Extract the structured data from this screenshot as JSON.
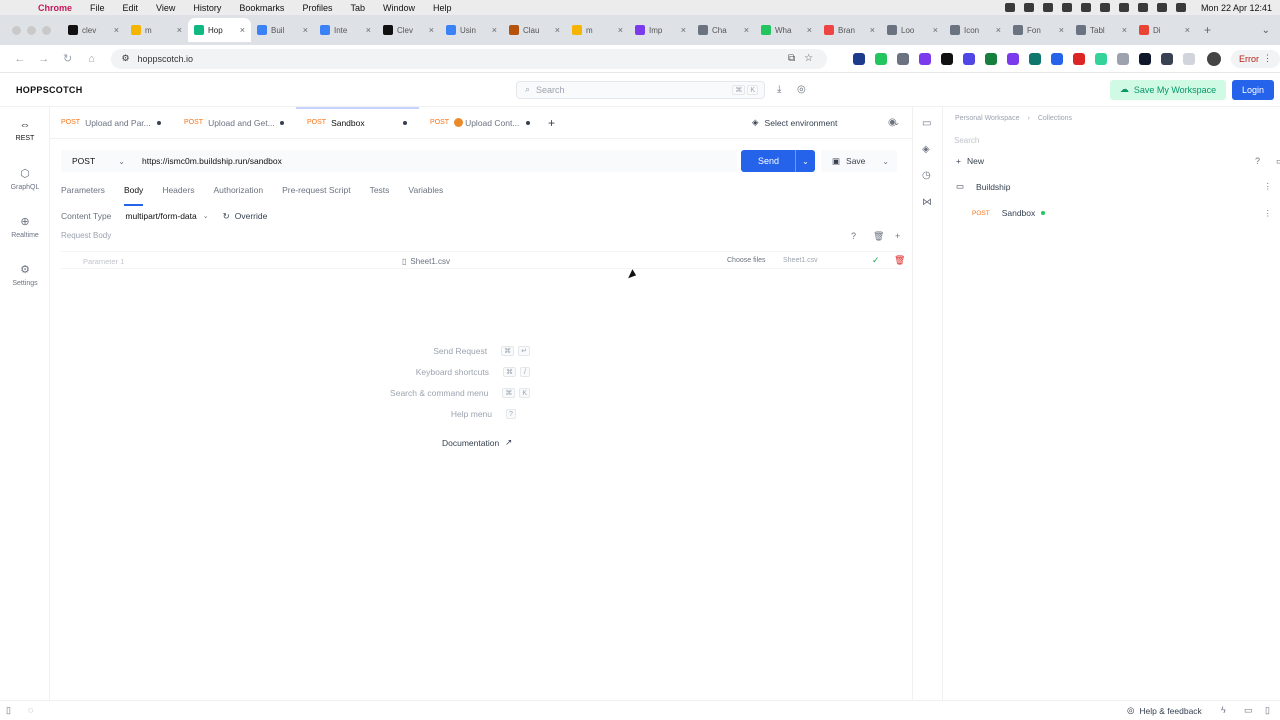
{
  "macos": {
    "app_name": "Chrome",
    "menu": [
      "File",
      "Edit",
      "View",
      "History",
      "Bookmarks",
      "Profiles",
      "Tab",
      "Window",
      "Help"
    ],
    "clock": "Mon 22 Apr  12:41"
  },
  "browser": {
    "tabs": [
      {
        "label": "clev",
        "color": "#111111"
      },
      {
        "label": "m",
        "color": "#f5b400"
      },
      {
        "label": "Hop",
        "color": "#10b981",
        "active": true
      },
      {
        "label": "Buil",
        "color": "#3b82f6"
      },
      {
        "label": "Inte",
        "color": "#3b82f6"
      },
      {
        "label": "Clev",
        "color": "#111111"
      },
      {
        "label": "Usin",
        "color": "#3b82f6"
      },
      {
        "label": "Clau",
        "color": "#b45309"
      },
      {
        "label": "m",
        "color": "#f5b400"
      },
      {
        "label": "Imp",
        "color": "#7c3aed"
      },
      {
        "label": "Cha",
        "color": "#6b7280"
      },
      {
        "label": "Wha",
        "color": "#22c55e"
      },
      {
        "label": "Bran",
        "color": "#ef4444"
      },
      {
        "label": "Loo",
        "color": "#6b7280"
      },
      {
        "label": "Icon",
        "color": "#6b7280"
      },
      {
        "label": "Fon",
        "color": "#6b7280"
      },
      {
        "label": "Tabl",
        "color": "#6b7280"
      },
      {
        "label": "Di",
        "color": "#ea4335"
      }
    ],
    "url": "hoppscotch.io",
    "error_label": "Error"
  },
  "app": {
    "logo": "HOPPSCOTCH",
    "search_placeholder": "Search",
    "search_kbd": [
      "⌘",
      "K"
    ],
    "save_workspace": "Save My Workspace",
    "login": "Login",
    "rail": [
      {
        "label": "REST",
        "icon": "link-icon"
      },
      {
        "label": "GraphQL",
        "icon": "graphql-icon"
      },
      {
        "label": "Realtime",
        "icon": "globe-icon"
      },
      {
        "label": "Settings",
        "icon": "gear-icon"
      }
    ],
    "request_tabs": [
      {
        "method": "POST",
        "name": "Upload and Par..."
      },
      {
        "method": "POST",
        "name": "Upload and Get..."
      },
      {
        "method": "POST",
        "name": "Sandbox"
      },
      {
        "method": "POST",
        "name": "Upload Cont..."
      }
    ],
    "environment": "Select environment",
    "request": {
      "method": "POST",
      "url": "https://ismc0m.buildship.run/sandbox",
      "send": "Send",
      "save": "Save"
    },
    "section_tabs": [
      "Parameters",
      "Body",
      "Headers",
      "Authorization",
      "Pre-request Script",
      "Tests",
      "Variables"
    ],
    "content_type_label": "Content Type",
    "content_type_value": "multipart/form-data",
    "override": "Override",
    "request_body_label": "Request Body",
    "param": {
      "placeholder": "Parameter 1",
      "file": "Sheet1.csv",
      "choose": "Choose files",
      "filename": "Sheet1.csv"
    },
    "shortcuts": [
      {
        "label": "Send Request",
        "keys": [
          "⌘",
          "↵"
        ]
      },
      {
        "label": "Keyboard shortcuts",
        "keys": [
          "⌘",
          "/"
        ]
      },
      {
        "label": "Search & command menu",
        "keys": [
          "⌘",
          "K"
        ]
      },
      {
        "label": "Help menu",
        "keys": [
          "?"
        ]
      }
    ],
    "documentation": "Documentation",
    "collections": {
      "breadcrumb": [
        "Personal Workspace",
        "Collections"
      ],
      "search_placeholder": "Search",
      "new": "New",
      "folder": "Buildship",
      "item_method": "POST",
      "item_name": "Sandbox"
    },
    "footer": {
      "help": "Help & feedback"
    }
  }
}
